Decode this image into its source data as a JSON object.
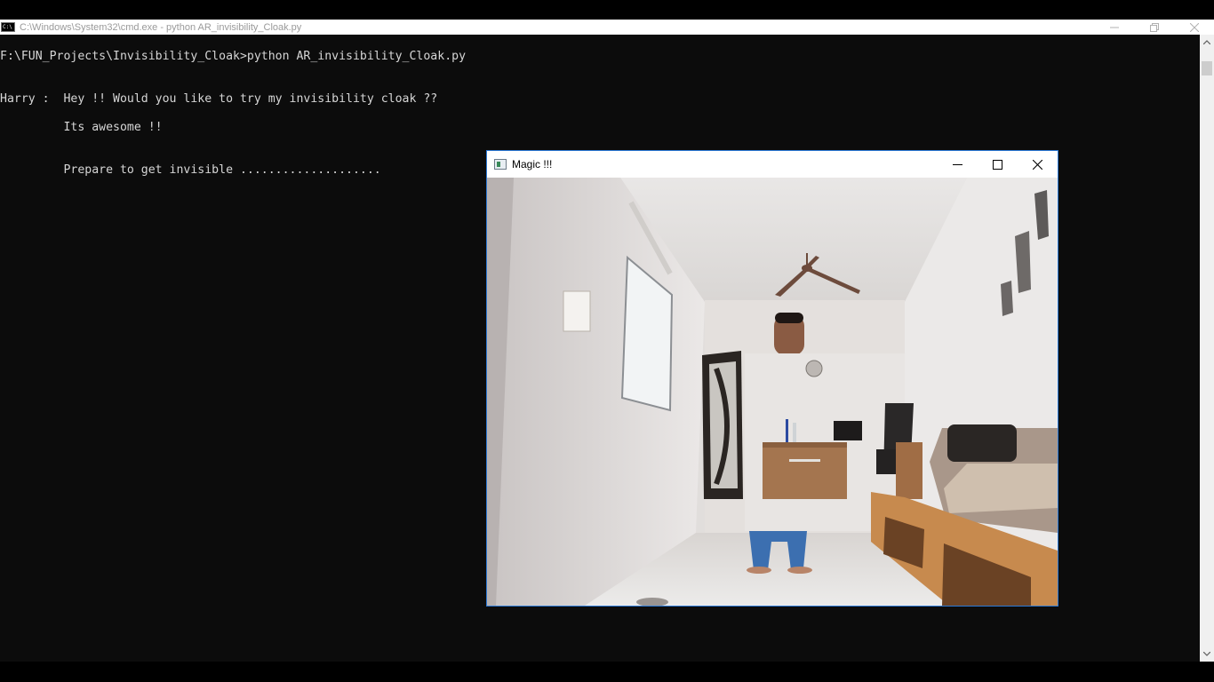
{
  "cmd_window": {
    "title": "C:\\Windows\\System32\\cmd.exe - python  AR_invisibility_Cloak.py",
    "controls": {
      "minimize": "minimize-icon",
      "restore": "restore-icon",
      "close": "close-icon"
    }
  },
  "console": {
    "lines": [
      "F:\\FUN_Projects\\Invisibility_Cloak>python AR_invisibility_Cloak.py",
      "Harry :  Hey !! Would you like to try my invisibility cloak ??",
      "         Its awesome !!",
      "         Prepare to get invisible ...................."
    ]
  },
  "magic_window": {
    "title": "Magic !!!",
    "controls": {
      "minimize": "minimize-icon",
      "maximize": "maximize-icon",
      "close": "close-icon"
    },
    "frame": "webcam feed of a room showing a person partially invisible behind a cloak"
  },
  "colors": {
    "console_bg": "#0c0c0c",
    "console_text": "#d6d6d6",
    "window_border": "#2b79d6"
  }
}
